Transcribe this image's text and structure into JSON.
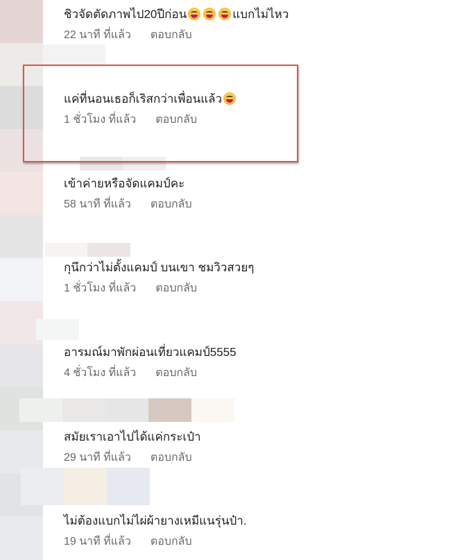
{
  "comments": [
    {
      "text": "ชิวจัดตัดภาพไป20ปีก่อน",
      "emoji_after_text": [
        "laughing-emoji",
        "laughing-emoji",
        "laughing-emoji"
      ],
      "text_suffix": "แบกไม่ไหว",
      "time": "22 นาที ที่แล้ว",
      "reply": "ตอบกลับ",
      "highlighted": false
    },
    {
      "text": "แค่ที่นอนเธอก็เริสกว่าเพื่อนแล้ว",
      "emoji_after_text": [
        "laughing-emoji"
      ],
      "text_suffix": "",
      "time": "1 ชั่วโมง ที่แล้ว",
      "reply": "ตอบกลับ",
      "highlighted": true
    },
    {
      "text": "เข้าค่ายหรือจัดแคมป์คะ",
      "emoji_after_text": [],
      "text_suffix": "",
      "time": "58 นาที ที่แล้ว",
      "reply": "ตอบกลับ",
      "highlighted": false
    },
    {
      "text": "กุนึกว่าไม่ตั้งแคมป์ บนเขา ชมวิวสวยๆ",
      "emoji_after_text": [],
      "text_suffix": "",
      "time": "1 ชั่วโมง ที่แล้ว",
      "reply": "ตอบกลับ",
      "highlighted": false
    },
    {
      "text": "อารมณ์มาพักผ่อนเที่ยวแคมป์5555",
      "emoji_after_text": [],
      "text_suffix": "",
      "time": "4 ชั่วโมง ที่แล้ว",
      "reply": "ตอบกลับ",
      "highlighted": false
    },
    {
      "text": "สมัยเราเอาไปได้แค่กระเป๋า",
      "emoji_after_text": [],
      "text_suffix": "",
      "time": "29 นาที ที่แล้ว",
      "reply": "ตอบกลับ",
      "highlighted": false
    },
    {
      "text": "ไม่ต้องแบกไม่ไผ่ผ้ายางเหมีแนรุ่นป๋า.",
      "emoji_after_text": [],
      "text_suffix": "",
      "time": "19 นาที ที่แล้ว",
      "reply": "ตอบกลับ",
      "highlighted": false
    }
  ],
  "colors": {
    "highlight_border": "#e05548",
    "comment_text": "#1c1e21",
    "meta_text": "#65676b"
  }
}
